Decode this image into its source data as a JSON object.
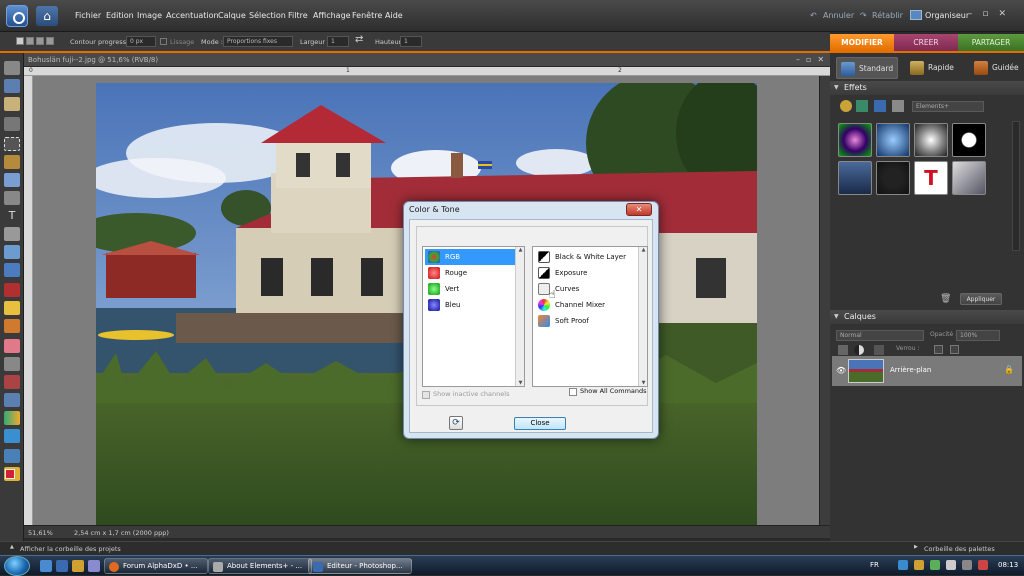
{
  "menubar": {
    "items": [
      "Fichier",
      "Edition",
      "Image",
      "Accentuation",
      "Calque",
      "Sélection",
      "Filtre",
      "Affichage",
      "Fenêtre",
      "Aide"
    ],
    "undo": "Annuler",
    "redo": "Rétablir",
    "organizer": "Organiseur"
  },
  "optbar": {
    "feather_label": "Contour progressif:",
    "feather_value": "0 px",
    "antialias": "Lissage",
    "mode_label": "Mode :",
    "mode_value": "Proportions fixes",
    "width_label": "Largeur :",
    "width_value": "1",
    "height_label": "Hauteur :",
    "height_value": "1"
  },
  "tabs": {
    "edit": "MODIFIER",
    "create": "CREER",
    "share": "PARTAGER"
  },
  "document": {
    "title": "Bohuslän fuji--2.jpg @ 51,6% (RVB/8)",
    "zoom": "51,61%",
    "size_info": "2,54 cm x 1,7 cm (2000 ppp)",
    "ruler_marks": [
      "1",
      "2"
    ]
  },
  "right_panel": {
    "modes": [
      "Standard",
      "Rapide",
      "Guidée"
    ],
    "effects_title": "Effets",
    "effects_select": "Elements+",
    "apply": "Appliquer",
    "layers_title": "Calques",
    "blend_mode": "Normal",
    "opacity_label": "Opacité :",
    "opacity_value": "100%",
    "lock_label": "Verrou :",
    "layer_name": "Arrière-plan"
  },
  "binbar": {
    "left": "Afficher la corbeille des projets",
    "right": "Corbeille des palettes"
  },
  "dialog": {
    "title": "Color & Tone",
    "channels": [
      "RGB",
      "Rouge",
      "Vert",
      "Bleu"
    ],
    "commands": [
      "Black & White Layer",
      "Exposure",
      "Curves",
      "Channel Mixer",
      "Soft Proof"
    ],
    "show_inactive": "Show inactive channels",
    "show_all": "Show All Commands",
    "close_button": "Close"
  },
  "taskbar": {
    "tasks": [
      "Forum AlphaDxD • ...",
      "About Elements+ - ...",
      "Editeur - Photoshop..."
    ],
    "language": "FR",
    "clock": "08:13"
  },
  "colors": {
    "accent_orange": "#e46f00",
    "create_tab": "#8e3560",
    "share_tab": "#4a8530",
    "selection_blue": "#3399ff"
  }
}
